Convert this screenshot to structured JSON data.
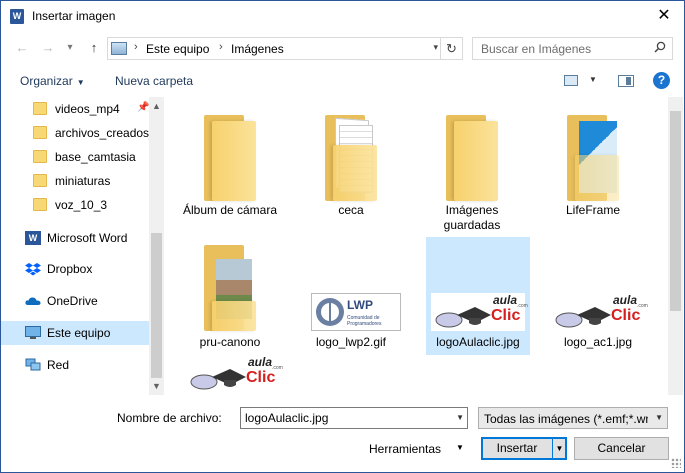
{
  "window": {
    "title": "Insertar imagen",
    "app_icon": "W",
    "close": "✕"
  },
  "nav": {
    "back": "←",
    "forward": "→",
    "dropdown": "▾",
    "up": "↑",
    "breadcrumb": [
      "Este equipo",
      "Imágenes"
    ],
    "separator": "›",
    "refresh": "↻",
    "search_placeholder": "Buscar en Imágenes"
  },
  "toolbar": {
    "organize": "Organizar",
    "new_folder": "Nueva carpeta",
    "help": "?"
  },
  "sidebar": {
    "quick_items": [
      "videos_mp4",
      "archivos_creados_",
      "base_camtasia",
      "miniaturas",
      "voz_10_3"
    ],
    "locations": [
      "Microsoft Word",
      "Dropbox",
      "OneDrive",
      "Este equipo",
      "Red"
    ],
    "selected": "Este equipo"
  },
  "files": [
    {
      "name": "Álbum de cámara",
      "kind": "folder"
    },
    {
      "name": "ceca",
      "kind": "folder-docs"
    },
    {
      "name": "Imágenes guardadas",
      "kind": "folder"
    },
    {
      "name": "LifeFrame",
      "kind": "folder-blue"
    },
    {
      "name": "pru-canono",
      "kind": "folder-photo"
    },
    {
      "name": "logo_lwp2.gif",
      "kind": "lwp"
    },
    {
      "name": "logoAulaclic.jpg",
      "kind": "aulaclic",
      "selected": true
    },
    {
      "name": "logo_ac1.jpg",
      "kind": "aulaclic"
    },
    {
      "name": "",
      "kind": "aulaclic"
    }
  ],
  "logos": {
    "lwp_title": "LWP",
    "lwp_subtitle_1": "Comunidad de",
    "lwp_subtitle_2": "Programadores",
    "aula": "aula",
    "clic": "Clic",
    "dotcom": ".com"
  },
  "footer": {
    "filename_label": "Nombre de archivo:",
    "filename_value": "logoAulaclic.jpg",
    "type_value": "Todas las imágenes (*.emf;*.wn",
    "tools": "Herramientas",
    "insert": "Insertar",
    "cancel": "Cancelar"
  },
  "colors": {
    "accent": "#0078d7",
    "selection": "#cce8ff",
    "link": "#1e395b",
    "clic_red": "#d62020"
  }
}
